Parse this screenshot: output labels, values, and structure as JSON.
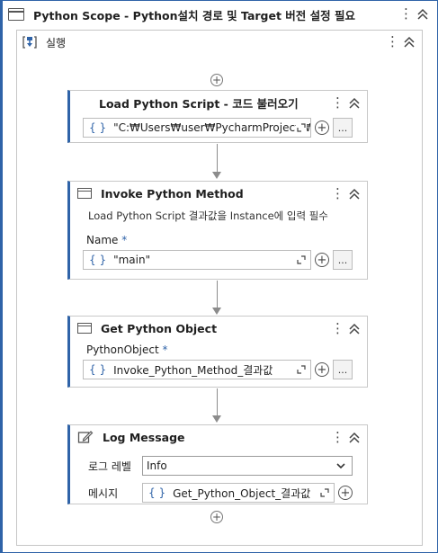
{
  "scope": {
    "title": "Python Scope - Python설치 경로 및 Target 버전 설정 필요"
  },
  "sequence": {
    "label": "실행"
  },
  "cards": [
    {
      "title": "Load Python Script - 코드 불러오기",
      "expression": "\"C:₩Users₩user₩PycharmProjects₩py",
      "more_label": "..."
    },
    {
      "title": "Invoke Python Method",
      "description": "Load Python Script 결과값을 Instance에 입력 필수",
      "field_label": "Name",
      "required_mark": "*",
      "expression": "\"main\"",
      "more_label": "..."
    },
    {
      "title": "Get Python Object",
      "field_label": "PythonObject",
      "required_mark": "*",
      "expression": "Invoke_Python_Method_결과값",
      "more_label": "..."
    },
    {
      "title": "Log Message",
      "level_label": "로그 레벨",
      "level_value": "Info",
      "message_label": "메시지",
      "message_expression": "Get_Python_Object_결과값"
    }
  ],
  "icons": {
    "brace": "{ }",
    "kebab": "⋮",
    "plus": "+"
  },
  "colors": {
    "accent": "#2f63a8"
  }
}
